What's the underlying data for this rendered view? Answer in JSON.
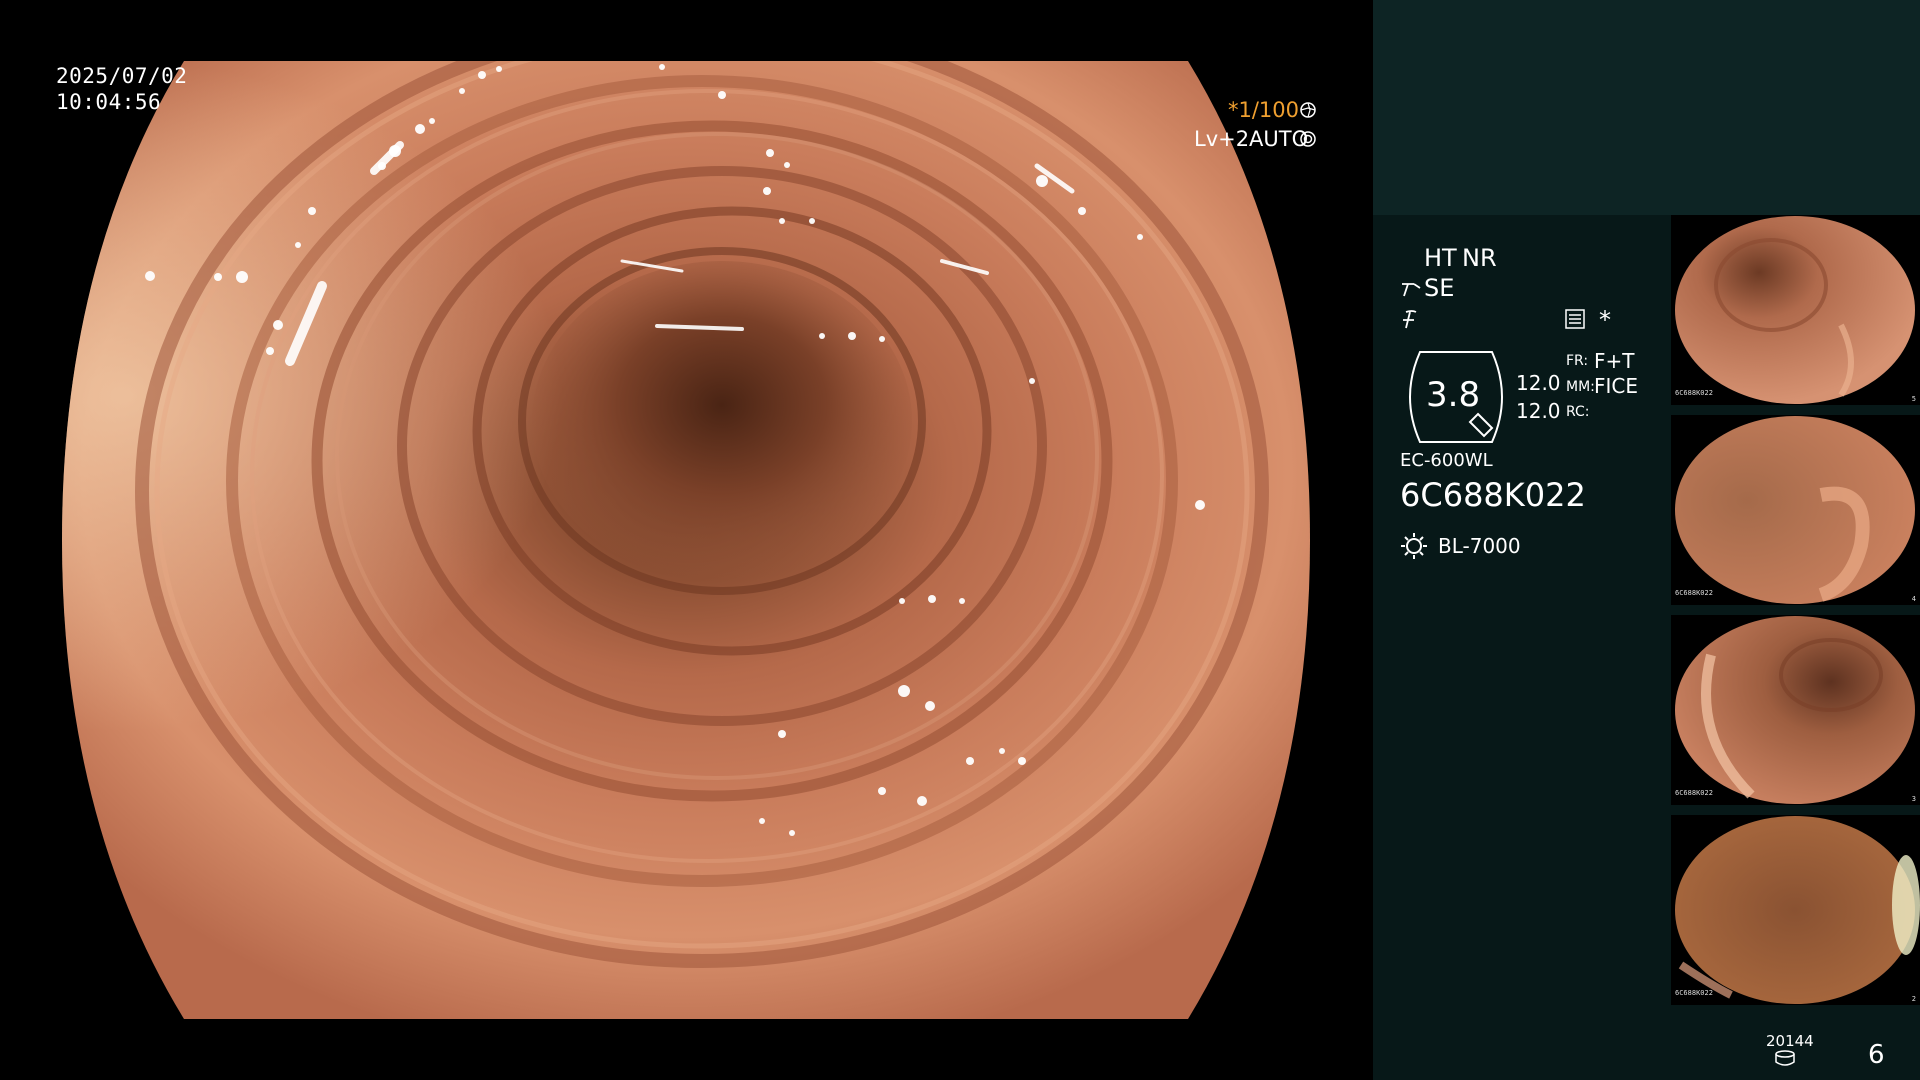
{
  "overlay": {
    "date": "2025/07/02",
    "time": "10:04:56",
    "shutter": "*1/100",
    "level": "Lv+2",
    "iris": "AUTO",
    "shutter_icon": "aperture-icon",
    "iris_icon": "iris-icon"
  },
  "panel": {
    "ht": "HT",
    "nr": "NR",
    "se": "SE",
    "star": "*",
    "zoom": "3.8",
    "val1": "12.0",
    "val2": "12.0",
    "fr_label": "FR:",
    "fr_value": "F+T",
    "mm_label": "MM:",
    "mm_value": "FICE",
    "rc_label": "RC:",
    "scope_model": "EC-600WL",
    "scope_serial": "6C688K022",
    "light_source": "BL-7000",
    "capture_count": "20144",
    "image_count": "6"
  },
  "thumbnails": [
    {
      "label": "6C688K022",
      "num": "5"
    },
    {
      "label": "6C688K022",
      "num": "4"
    },
    {
      "label": "6C688K022",
      "num": "3"
    },
    {
      "label": "6C688K022",
      "num": "2"
    }
  ],
  "colors": {
    "accent": "#f0a030",
    "panel_bg": "#071818",
    "panel_top": "#0d2424",
    "tissue": "#c7785a"
  }
}
